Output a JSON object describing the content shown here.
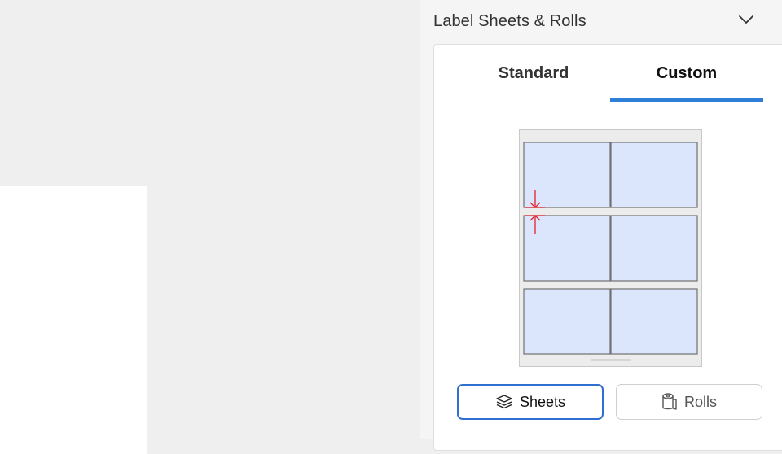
{
  "panel": {
    "title": "Label Sheets & Rolls",
    "collapse_icon": "chevron-down-icon"
  },
  "tabs": [
    {
      "label": "Standard",
      "selected": false
    },
    {
      "label": "Custom",
      "selected": true
    }
  ],
  "preview": {
    "rows": 3,
    "columns": 2,
    "label_fill_color": "#dbe6fd",
    "indicator_color": "#e8202a",
    "indicator_icon": "vertical-gap-arrows-icon"
  },
  "buttons": {
    "sheets": {
      "label": "Sheets",
      "icon": "stacked-sheets-icon",
      "selected": true
    },
    "rolls": {
      "label": "Rolls",
      "icon": "label-roll-icon",
      "selected": false
    }
  },
  "colors": {
    "accent": "#2f7fd8",
    "selected_border": "#2f6fd0"
  }
}
